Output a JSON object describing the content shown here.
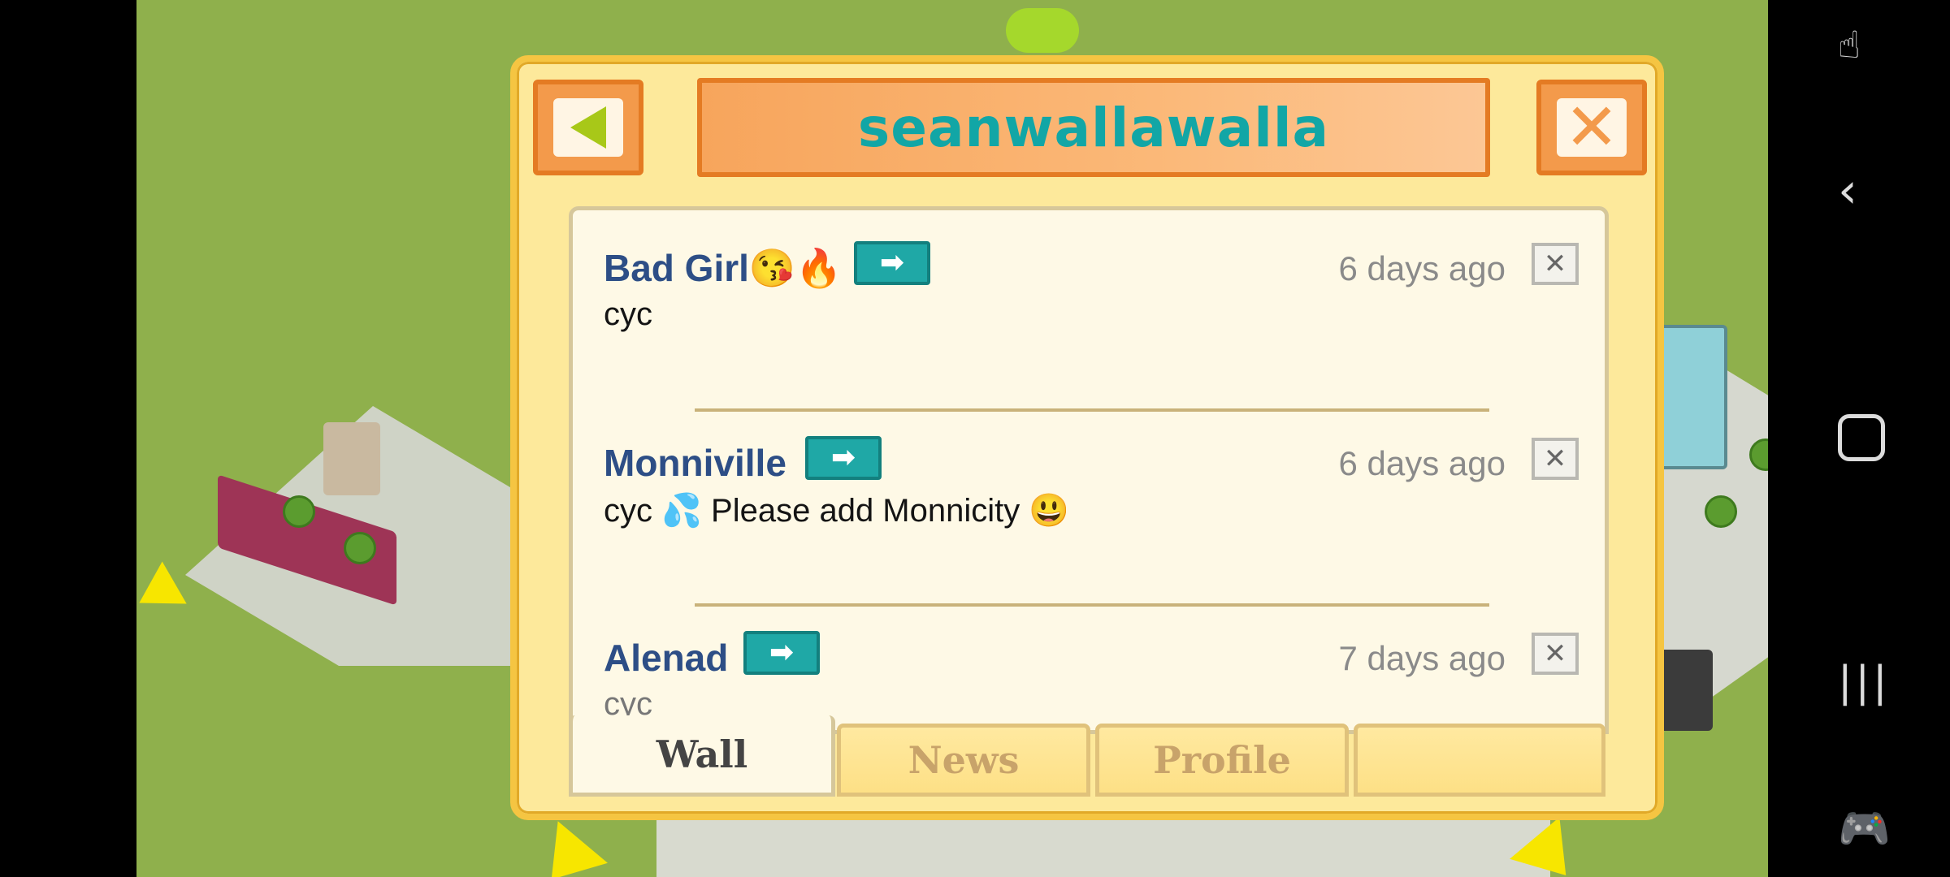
{
  "dialog": {
    "title": "seanwallawalla",
    "back_icon": "back-triangle-icon",
    "close_icon": "close-x-icon"
  },
  "posts": [
    {
      "name": "Bad Girl😘🔥",
      "time": "6 days ago",
      "message": "cyc"
    },
    {
      "name": "Monniville",
      "time": "6 days ago",
      "message": "cyc 💦 Please add Monnicity 😃"
    },
    {
      "name": "Alenad",
      "time": "7 days ago",
      "message": "cyc"
    }
  ],
  "tabs": [
    {
      "label": "Wall",
      "active": true
    },
    {
      "label": "News",
      "active": false
    },
    {
      "label": "Profile",
      "active": false
    },
    {
      "label": "",
      "active": false
    }
  ],
  "colors": {
    "title": "#12a6a6",
    "name": "#2d4e86",
    "dialog_bg": "#fde99b",
    "header_orange": "#f39a4b"
  },
  "navbar": {
    "icons": [
      "screenshot-touch-icon",
      "back-icon",
      "home-icon",
      "recents-icon",
      "game-controller-icon"
    ]
  }
}
